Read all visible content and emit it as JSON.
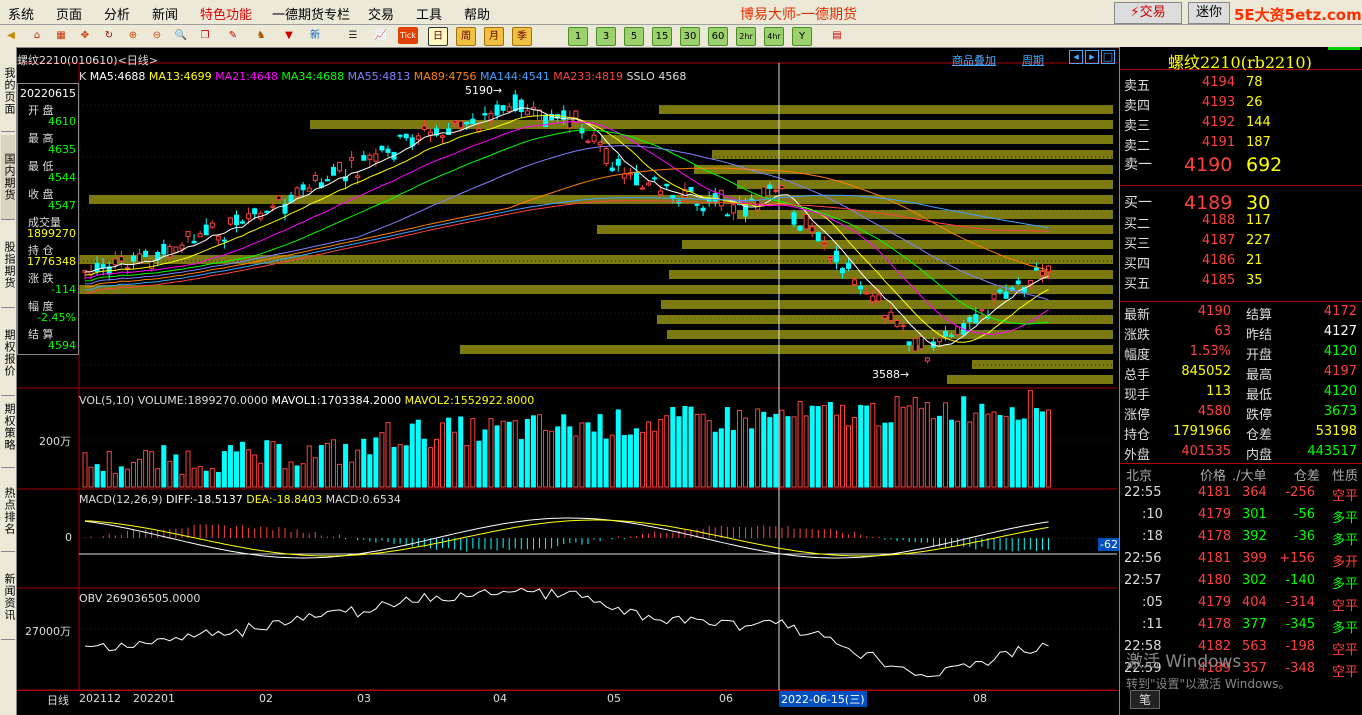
{
  "menu": {
    "items": [
      "系统",
      "页面",
      "分析",
      "新闻",
      "特色功能",
      "一德期货专栏",
      "交易",
      "工具",
      "帮助"
    ],
    "title": "博易大师-一德期货",
    "trade_btn": "交易",
    "mini_btn": "迷你",
    "watermark": "5E大资5etz.com"
  },
  "toolbar": {
    "periods": [
      "日",
      "周",
      "月",
      "季",
      "1",
      "3",
      "5",
      "15",
      "30",
      "60",
      "2hr",
      "4hr",
      "Y"
    ],
    "tick_label": "Tick"
  },
  "leftnav": [
    "我的页面",
    "国内期货",
    "股指期货",
    "期权报价",
    "期权策略",
    "热点排名",
    "新闻资讯"
  ],
  "chart": {
    "symbol_label": "螺纹2210(010610)<日线>",
    "overlay_links": [
      "商品叠加",
      "周期"
    ],
    "ma_prefix": "K",
    "ma": [
      {
        "label": "MA5:4688",
        "color": "#ffffff"
      },
      {
        "label": "MA13:4699",
        "color": "#ffff00"
      },
      {
        "label": "MA21:4648",
        "color": "#ff00ff"
      },
      {
        "label": "MA34:4688",
        "color": "#00ff00"
      },
      {
        "label": "MA55:4813",
        "color": "#8080ff"
      },
      {
        "label": "MA89:4756",
        "color": "#ff8000"
      },
      {
        "label": "MA144:4541",
        "color": "#40a0ff"
      },
      {
        "label": "MA233:4819",
        "color": "#ff4040"
      },
      {
        "label": "SSLO 4568",
        "color": "#dddddd"
      }
    ],
    "high_mark": "5190",
    "low_mark": "3588",
    "info": {
      "date": "20220615",
      "rows": [
        {
          "label": "开 盘",
          "value": "4610",
          "color": "#00ff00"
        },
        {
          "label": "最 高",
          "value": "4635",
          "color": "#00ff00"
        },
        {
          "label": "最 低",
          "value": "4544",
          "color": "#00ff00"
        },
        {
          "label": "收 盘",
          "value": "4547",
          "color": "#00ff00"
        },
        {
          "label": "成交量",
          "value": "1899270",
          "color": "#ffff00"
        },
        {
          "label": "持 仓",
          "value": "1776348",
          "color": "#ffff00"
        },
        {
          "label": "涨 跌",
          "value": "-114",
          "color": "#00ff00"
        },
        {
          "label": "幅 度",
          "value": "-2.45%",
          "color": "#00ff00"
        },
        {
          "label": "结 算",
          "value": "4594",
          "color": "#00ff00"
        }
      ]
    },
    "vol_header": "VOL(5,10) VOLUME:1899270.0000",
    "vol_mavol1": "MAVOL1:1703384.2000",
    "vol_mavol2": "MAVOL2:1552922.8000",
    "vol_axis": "200万",
    "macd_header": "MACD(12,26,9)",
    "macd_diff": "DIFF:-18.5137",
    "macd_dea": "DEA:-18.8403",
    "macd_val": "MACD:0.6534",
    "macd_axis": "0",
    "macd_cursor_val": "-62",
    "obv_header": "OBV 269036505.0000",
    "obv_axis": "27000万",
    "x_axis": {
      "prefix": "日线",
      "labels": [
        "202112",
        "202201",
        "02",
        "03",
        "04",
        "05",
        "06",
        "08"
      ],
      "cursor_date": "2022-06-15(三)"
    }
  },
  "quote": {
    "title": "螺纹2210(rb2210)",
    "asks": [
      {
        "label": "卖五",
        "price": "4194",
        "vol": "78"
      },
      {
        "label": "卖四",
        "price": "4193",
        "vol": "26"
      },
      {
        "label": "卖三",
        "price": "4192",
        "vol": "144"
      },
      {
        "label": "卖二",
        "price": "4191",
        "vol": "187"
      },
      {
        "label": "卖一",
        "price": "4190",
        "vol": "692"
      }
    ],
    "bids": [
      {
        "label": "买一",
        "price": "4189",
        "vol": "30"
      },
      {
        "label": "买二",
        "price": "4188",
        "vol": "117"
      },
      {
        "label": "买三",
        "price": "4187",
        "vol": "227"
      },
      {
        "label": "买四",
        "price": "4186",
        "vol": "21"
      },
      {
        "label": "买五",
        "price": "4185",
        "vol": "35"
      }
    ],
    "stats": [
      {
        "l1": "最新",
        "v1": "4190",
        "c1": "#ff4040",
        "l2": "结算",
        "v2": "4172",
        "c2": "#ff4040"
      },
      {
        "l1": "涨跌",
        "v1": "63",
        "c1": "#ff4040",
        "l2": "昨结",
        "v2": "4127",
        "c2": "#ffffff"
      },
      {
        "l1": "幅度",
        "v1": "1.53%",
        "c1": "#ff4040",
        "l2": "开盘",
        "v2": "4120",
        "c2": "#00ff00"
      },
      {
        "l1": "总手",
        "v1": "845052",
        "c1": "#ffff00",
        "l2": "最高",
        "v2": "4197",
        "c2": "#ff4040"
      },
      {
        "l1": "现手",
        "v1": "113",
        "c1": "#ffff00",
        "l2": "最低",
        "v2": "4120",
        "c2": "#00ff00"
      },
      {
        "l1": "涨停",
        "v1": "4580",
        "c1": "#ff4040",
        "l2": "跌停",
        "v2": "3673",
        "c2": "#00ff00"
      },
      {
        "l1": "持仓",
        "v1": "1791966",
        "c1": "#ffff00",
        "l2": "仓差",
        "v2": "53198",
        "c2": "#ffff00"
      },
      {
        "l1": "外盘",
        "v1": "401535",
        "c1": "#ff4040",
        "l2": "内盘",
        "v2": "443517",
        "c2": "#00ff00"
      }
    ],
    "tick_header": {
      "city": "北京",
      "price": "价格",
      "vol": "./大单",
      "oi": "仓差",
      "nature": "性质"
    },
    "ticks": [
      {
        "time": "22:55",
        "price": "4181",
        "vol": "364",
        "oi": "-256",
        "nature": "空平",
        "pc": "#ff4040",
        "vc": "#ff4040",
        "nc": "#ff4040"
      },
      {
        "time": ":10",
        "price": "4179",
        "vol": "301",
        "oi": "-56",
        "nature": "多平",
        "pc": "#ff4040",
        "vc": "#00ff00",
        "nc": "#00ff00"
      },
      {
        "time": ":18",
        "price": "4178",
        "vol": "392",
        "oi": "-36",
        "nature": "多平",
        "pc": "#ff4040",
        "vc": "#00ff00",
        "nc": "#00ff00"
      },
      {
        "time": "22:56",
        "price": "4181",
        "vol": "399",
        "oi": "+156",
        "nature": "多开",
        "pc": "#ff4040",
        "vc": "#ff4040",
        "nc": "#ff4040"
      },
      {
        "time": "22:57",
        "price": "4180",
        "vol": "302",
        "oi": "-140",
        "nature": "多平",
        "pc": "#ff4040",
        "vc": "#00ff00",
        "nc": "#00ff00"
      },
      {
        "time": ":05",
        "price": "4179",
        "vol": "404",
        "oi": "-314",
        "nature": "空平",
        "pc": "#ff4040",
        "vc": "#ff4040",
        "nc": "#ff4040"
      },
      {
        "time": ":11",
        "price": "4178",
        "vol": "377",
        "oi": "-345",
        "nature": "多平",
        "pc": "#ff4040",
        "vc": "#00ff00",
        "nc": "#00ff00"
      },
      {
        "time": "22:58",
        "price": "4182",
        "vol": "563",
        "oi": "-198",
        "nature": "空平",
        "pc": "#ff4040",
        "vc": "#ff4040",
        "nc": "#ff4040"
      },
      {
        "time": "22:59",
        "price": "4189",
        "vol": "357",
        "oi": "-348",
        "nature": "空平",
        "pc": "#ff4040",
        "vc": "#ff4040",
        "nc": "#ff4040"
      }
    ],
    "bottom_tab": "笔",
    "activate1": "激活 Windows",
    "activate2": "转到\"设置\"以激活 Windows。"
  }
}
